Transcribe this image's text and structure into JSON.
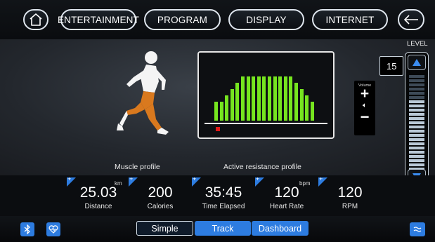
{
  "nav": {
    "home_icon": "home-icon",
    "entertainment": "ENTERTAINMENT",
    "program": "PROGRAM",
    "display": "DISPLAY",
    "internet": "INTERNET",
    "back_icon": "arrow-left-icon"
  },
  "main": {
    "muscle_profile_label": "Muscle profile",
    "resistance_profile_label": "Active resistance profile",
    "resistance_bars": [
      3,
      3,
      4,
      5,
      6,
      7,
      7,
      7,
      7,
      7,
      7,
      7,
      7,
      7,
      7,
      6,
      5,
      4,
      3
    ],
    "volume": {
      "label": "Volume",
      "plus": "+",
      "speaker_icon": "speaker-icon",
      "minus": "−"
    },
    "level": {
      "title": "LEVEL",
      "value": "15",
      "up_icon": "triangle-up-icon",
      "down_icon": "triangle-down-icon",
      "fill": 0.75
    }
  },
  "stats": [
    {
      "value": "25.03",
      "unit": "km",
      "label": "Distance"
    },
    {
      "value": "200",
      "unit": "",
      "label": "Calories"
    },
    {
      "value": "35:45",
      "unit": "",
      "label": "Time Elapsed"
    },
    {
      "value": "120",
      "unit": "bpm",
      "label": "Heart Rate"
    },
    {
      "value": "120",
      "unit": "",
      "label": "RPM"
    }
  ],
  "bottom": {
    "bluetooth_icon": "bluetooth-icon",
    "heart_icon": "heart-rate-icon",
    "tabs": [
      "Simple",
      "Track",
      "Dashboard"
    ],
    "menu_icon": "waves-menu-icon"
  },
  "colors": {
    "accent_blue": "#2d7ce0",
    "bar_green": "#76e51f",
    "marker_red": "#e21818",
    "muscle_orange": "#d9791e"
  }
}
